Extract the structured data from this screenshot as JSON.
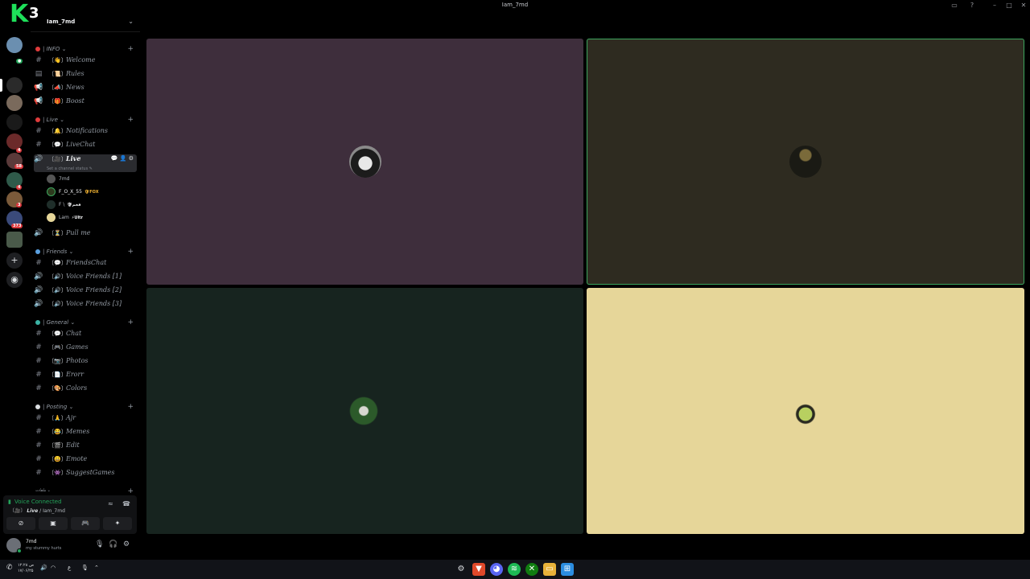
{
  "window": {
    "title": "Iam_7md"
  },
  "overlay": {
    "digit": "3"
  },
  "server": {
    "name": "Iam_7md"
  },
  "rail": {
    "badges": {
      "b1": "4",
      "b2": "58",
      "b3": "3",
      "b4": "373"
    }
  },
  "categories": {
    "info": "| INFO ⌄",
    "live": "| Live ⌄",
    "friends": "| Friends ⌄",
    "general": "| General ⌄",
    "posting": "| Posting ⌄",
    "more": "ملفات ⌄"
  },
  "channels": {
    "welcome": "Welcome",
    "rules": "Rules",
    "news": "News",
    "boost": "Boost",
    "notifications": "Notifications",
    "livechat": "LiveChat",
    "live": "Live",
    "pullme": "Pull me",
    "friendschat": "FriendsChat",
    "vf1": "Voice Friends [1]",
    "vf2": "Voice Friends [2]",
    "vf3": "Voice Friends [3]",
    "chat": "Chat",
    "games": "Games",
    "photos": "Photos",
    "erorr": "Erorr",
    "colors": "Colors",
    "ajr": "Ajr",
    "memes": "Memes",
    "edit": "Edit",
    "emote": "Emote",
    "suggestgames": "SuggestGames"
  },
  "live_status": "Set a channel status ✎",
  "voice_users": [
    {
      "name": "7md",
      "tag": ""
    },
    {
      "name": "F_O_X_55",
      "tag": "🛡FOX"
    },
    {
      "name": "F \\",
      "tag": "🛡فخم"
    },
    {
      "name": "Lam",
      "tag": "⚡Ultr"
    }
  ],
  "voice_panel": {
    "status": "Voice Connected",
    "channel": "Live",
    "server": "Iam_7md"
  },
  "user": {
    "name": "7md",
    "status": "my stummy hurts"
  },
  "taskbar": {
    "time": "۱۲:۲۸ ص",
    "date": "۱۷/۰۶/۲۵",
    "lang": "ع"
  },
  "colors": {
    "tile1": "#3e2e3c",
    "tile2": "#2e2b20",
    "tile3": "#17241f",
    "tile4": "#e6d699",
    "speaking": "#3ba55d"
  }
}
